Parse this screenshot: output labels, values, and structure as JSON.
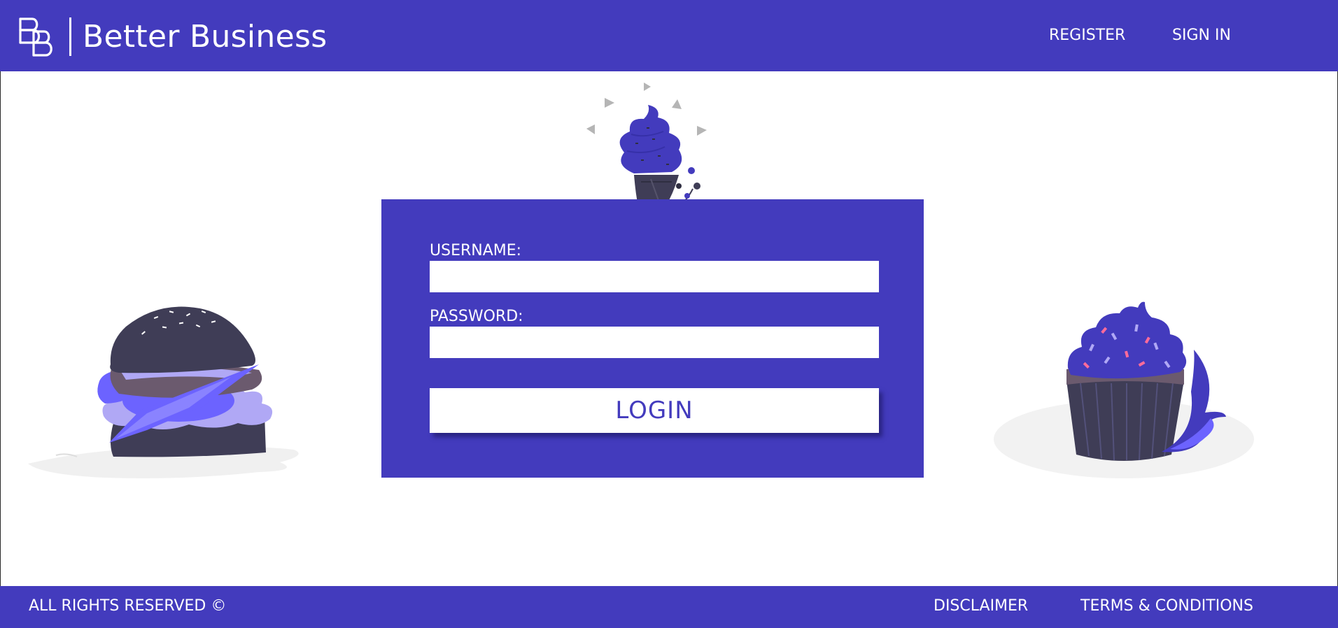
{
  "header": {
    "brand_name": "Better Business",
    "logo_icon": "bb-monogram-logo",
    "nav": {
      "register_label": "REGISTER",
      "signin_label": "SIGN IN"
    }
  },
  "login_form": {
    "username_label": "USERNAME:",
    "username_value": "",
    "password_label": "PASSWORD:",
    "password_value": "",
    "login_button_label": "LOGIN"
  },
  "illustrations": [
    "ice-cream-cone",
    "burger",
    "cupcake"
  ],
  "footer": {
    "rights_text": "ALL RIGHTS RESERVED ©",
    "disclaimer_label": "DISCLAIMER",
    "terms_label": "TERMS & CONDITIONS"
  },
  "colors": {
    "brand_primary": "#433bbd",
    "dark_ink": "#3f3d56",
    "light_purple": "#b0a8f5",
    "mid_purple": "#6c63ff"
  }
}
